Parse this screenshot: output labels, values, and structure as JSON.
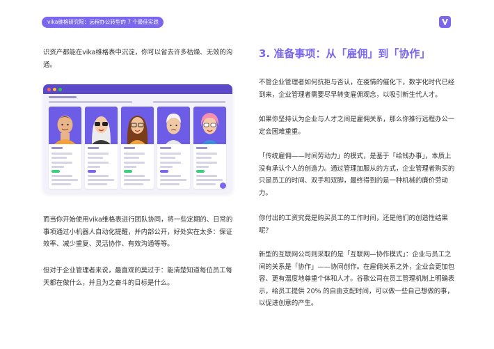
{
  "header": {
    "title": "vika维格研究院：远程办公转型的 7 个最佳实践",
    "logo_icon": "vika-logo-icon",
    "accent_color": "#7b67ee"
  },
  "left": {
    "intro": "识资产都能在vika维格表中沉淀，你可以省去许多枯燥、无效的沟通。",
    "image": {
      "icon": "vika-team-gallery-screenshot"
    },
    "para1": "而当你开始使用vika维格表进行团队协同，将一些定期的、日常的事项通过小机器人自动化提醒，并内部公开，好处实在太多：保证效率、减少重复、灵活协作、有效沟通等等。",
    "para2": "但对于企业管理者来说，最直观的莫过于：能清楚知道每位员工每天都在做什么，并且为之奋斗的目标是什么。"
  },
  "right": {
    "heading": "3. 准备事项：从「雇佣」到「协作」",
    "p1": "不管企业管理者如何抗拒与否认，在疫情的催化下，数字化时代已经到来，企业管理者需要尽早转变雇佣观念，以吸引新生代人才。",
    "p2": "如果你坚持认为企业与人才之间是雇佣关系，那么你推行远程办公一定会困难重重。",
    "p3": "「传统雇佣——时间劳动力」的模式，是基于「给钱办事」，本质上没有承认个人的创造力。通过管理加服从的方式，企业管理者购买的只是员工的时间、双手和双脚，最终得到的是一种机械的廉价劳动力。",
    "p4": "你付出的工资究竟是购买员工的工作时间，还是他们的创造性结果呢？",
    "p5": "新型的互联网公司则采取的是「互联网—协作模式」：企业与员工之间的关系是「协作」——协同创作。在雇佣关系之外，企业会更加包容、更有温度地尊重个体和人才。谷歌公司在员工管理机制上明确表示，给员工提供 20% 的自由支配时间，可以做一些自己想做的事，以促进创意的产生。"
  }
}
